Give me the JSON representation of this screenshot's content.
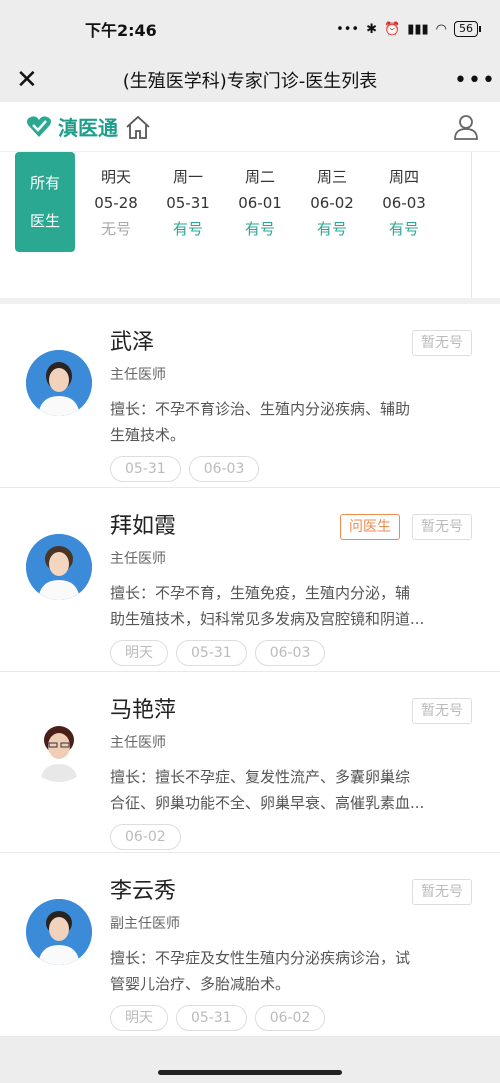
{
  "status": {
    "time": "下午2:46",
    "battery": "56"
  },
  "nav": {
    "title": "(生殖医学科)专家门诊-医生列表"
  },
  "brand": {
    "name": "滇医通",
    "accent": "#2ba892"
  },
  "filter": {
    "all_line1": "所有",
    "all_line2": "医生"
  },
  "dates": [
    {
      "day": "明天",
      "date": "05-28",
      "status": "无号"
    },
    {
      "day": "周一",
      "date": "05-31",
      "status": "有号"
    },
    {
      "day": "周二",
      "date": "06-01",
      "status": "有号"
    },
    {
      "day": "周三",
      "date": "06-02",
      "status": "有号"
    },
    {
      "day": "周四",
      "date": "06-03",
      "status": "有号"
    }
  ],
  "doctors": [
    {
      "name": "武泽",
      "title": "主任医师",
      "skill_line1": "擅长：不孕不育诊治、生殖内分泌疾病、辅助",
      "skill_line2": "生殖技术。",
      "badge": "暂无号",
      "chips": [
        "05-31",
        "06-03"
      ]
    },
    {
      "name": "拜如霞",
      "title": "主任医师",
      "skill_line1": "擅长：不孕不育，生殖免疫，生殖内分泌，辅",
      "skill_line2": "助生殖技术，妇科常见多发病及宫腔镜和阴道...",
      "ask": "问医生",
      "badge": "暂无号",
      "chips": [
        "明天",
        "05-31",
        "06-03"
      ]
    },
    {
      "name": "马艳萍",
      "title": "主任医师",
      "skill_line1": "擅长：擅长不孕症、复发性流产、多囊卵巢综",
      "skill_line2": "合征、卵巢功能不全、卵巢早衰、高催乳素血...",
      "badge": "暂无号",
      "chips": [
        "06-02"
      ]
    },
    {
      "name": "李云秀",
      "title": "副主任医师",
      "skill_line1": "擅长：不孕症及女性生殖内分泌疾病诊治，试",
      "skill_line2": "管婴儿治疗、多胎减胎术。",
      "badge": "暂无号",
      "chips": [
        "明天",
        "05-31",
        "06-02"
      ]
    }
  ]
}
